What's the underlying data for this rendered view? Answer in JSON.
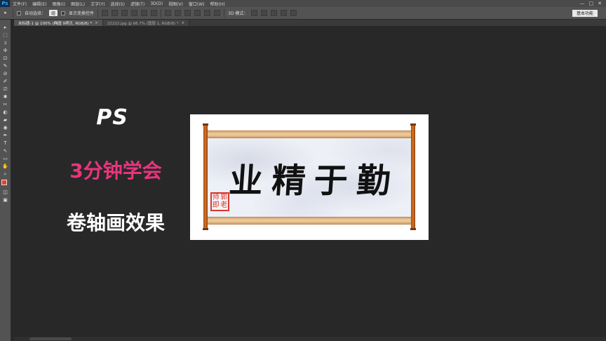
{
  "app": {
    "logo": "Ps"
  },
  "menu": [
    "文件(F)",
    "编辑(E)",
    "图像(I)",
    "图层(L)",
    "文字(Y)",
    "选择(S)",
    "滤镜(T)",
    "3D(D)",
    "视图(V)",
    "窗口(W)",
    "帮助(H)"
  ],
  "window_controls": {
    "minimize": "—",
    "maximize": "□",
    "close": "✕"
  },
  "options": {
    "auto_select_label": "自动选择：",
    "auto_select_value": "组",
    "show_transform_label": "显示变换控件",
    "mode_3d_label": "3D 模式：",
    "workspace": "基本功能"
  },
  "tabs": [
    {
      "label": "未标题-1 @ 100% (椭圆 9拷贝, RGB/8) *",
      "close": "×"
    },
    {
      "label": "22222.jpg @ 66.7% (图层 1, RGB/8) *",
      "close": "×"
    }
  ],
  "tools": [
    "▸",
    "⬚",
    "ↄ",
    "✣",
    "⊡",
    "✎",
    "⊘",
    "✐",
    "⎚",
    "✱",
    "✂",
    "◐",
    "▰",
    "◉",
    "✒",
    "T",
    "↖",
    "▭",
    "✋",
    "⌕"
  ],
  "colors": {
    "foreground": "#e8402d",
    "background": "#ffffff"
  },
  "canvas": {
    "heading": "PS",
    "subheading": "3分钟学会",
    "title": "卷轴画效果"
  },
  "artwork": {
    "characters": [
      "业",
      "精",
      "于",
      "勤"
    ],
    "seal": [
      "师",
      "郭",
      "即",
      "老"
    ]
  }
}
